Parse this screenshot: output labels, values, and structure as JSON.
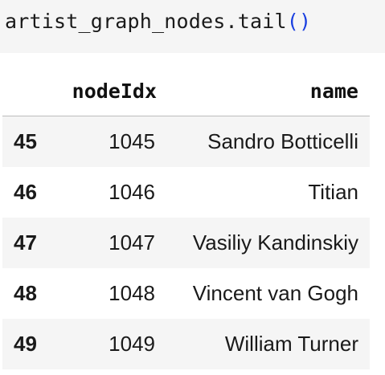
{
  "code_cell": {
    "prefix": "artist_graph_nodes.tail",
    "parens": "()"
  },
  "table": {
    "columns": [
      "",
      "nodeIdx",
      "name"
    ],
    "rows": [
      {
        "index": "45",
        "nodeIdx": "1045",
        "name": "Sandro Botticelli"
      },
      {
        "index": "46",
        "nodeIdx": "1046",
        "name": "Titian"
      },
      {
        "index": "47",
        "nodeIdx": "1047",
        "name": "Vasiliy Kandinskiy"
      },
      {
        "index": "48",
        "nodeIdx": "1048",
        "name": "Vincent van Gogh"
      },
      {
        "index": "49",
        "nodeIdx": "1049",
        "name": "William Turner"
      }
    ]
  }
}
